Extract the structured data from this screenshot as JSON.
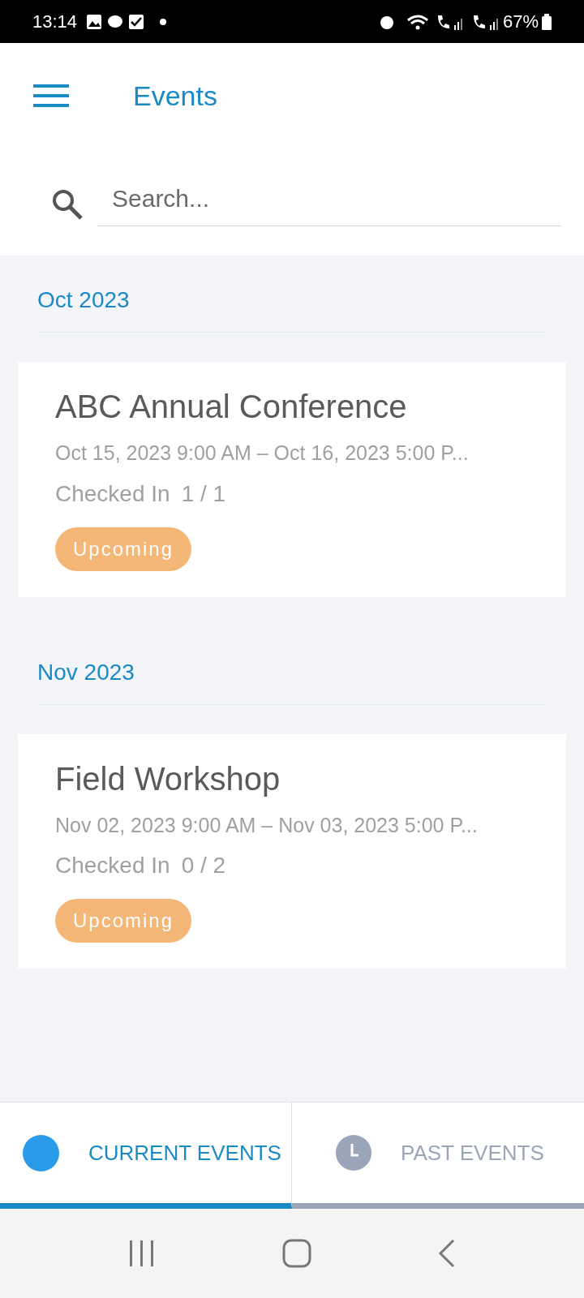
{
  "status_bar": {
    "time": "13:14",
    "battery": "67%"
  },
  "header": {
    "title": "Events"
  },
  "search": {
    "placeholder": "Search..."
  },
  "groups": [
    {
      "month": "Oct 2023",
      "events": [
        {
          "title": "ABC Annual Conference",
          "dates": "Oct 15, 2023 9:00 AM – Oct 16, 2023 5:00 P...",
          "checked_in_label": "Checked In",
          "checked_in": "1 / 1",
          "status": "Upcoming"
        }
      ]
    },
    {
      "month": "Nov 2023",
      "events": [
        {
          "title": "Field Workshop",
          "dates": "Nov 02, 2023 9:00 AM – Nov 03, 2023 5:00 P...",
          "checked_in_label": "Checked In",
          "checked_in": "0 / 2",
          "status": "Upcoming"
        }
      ]
    }
  ],
  "tabs": [
    {
      "label": "CURRENT EVENTS",
      "selected": true
    },
    {
      "label": "PAST EVENTS",
      "selected": false
    }
  ]
}
